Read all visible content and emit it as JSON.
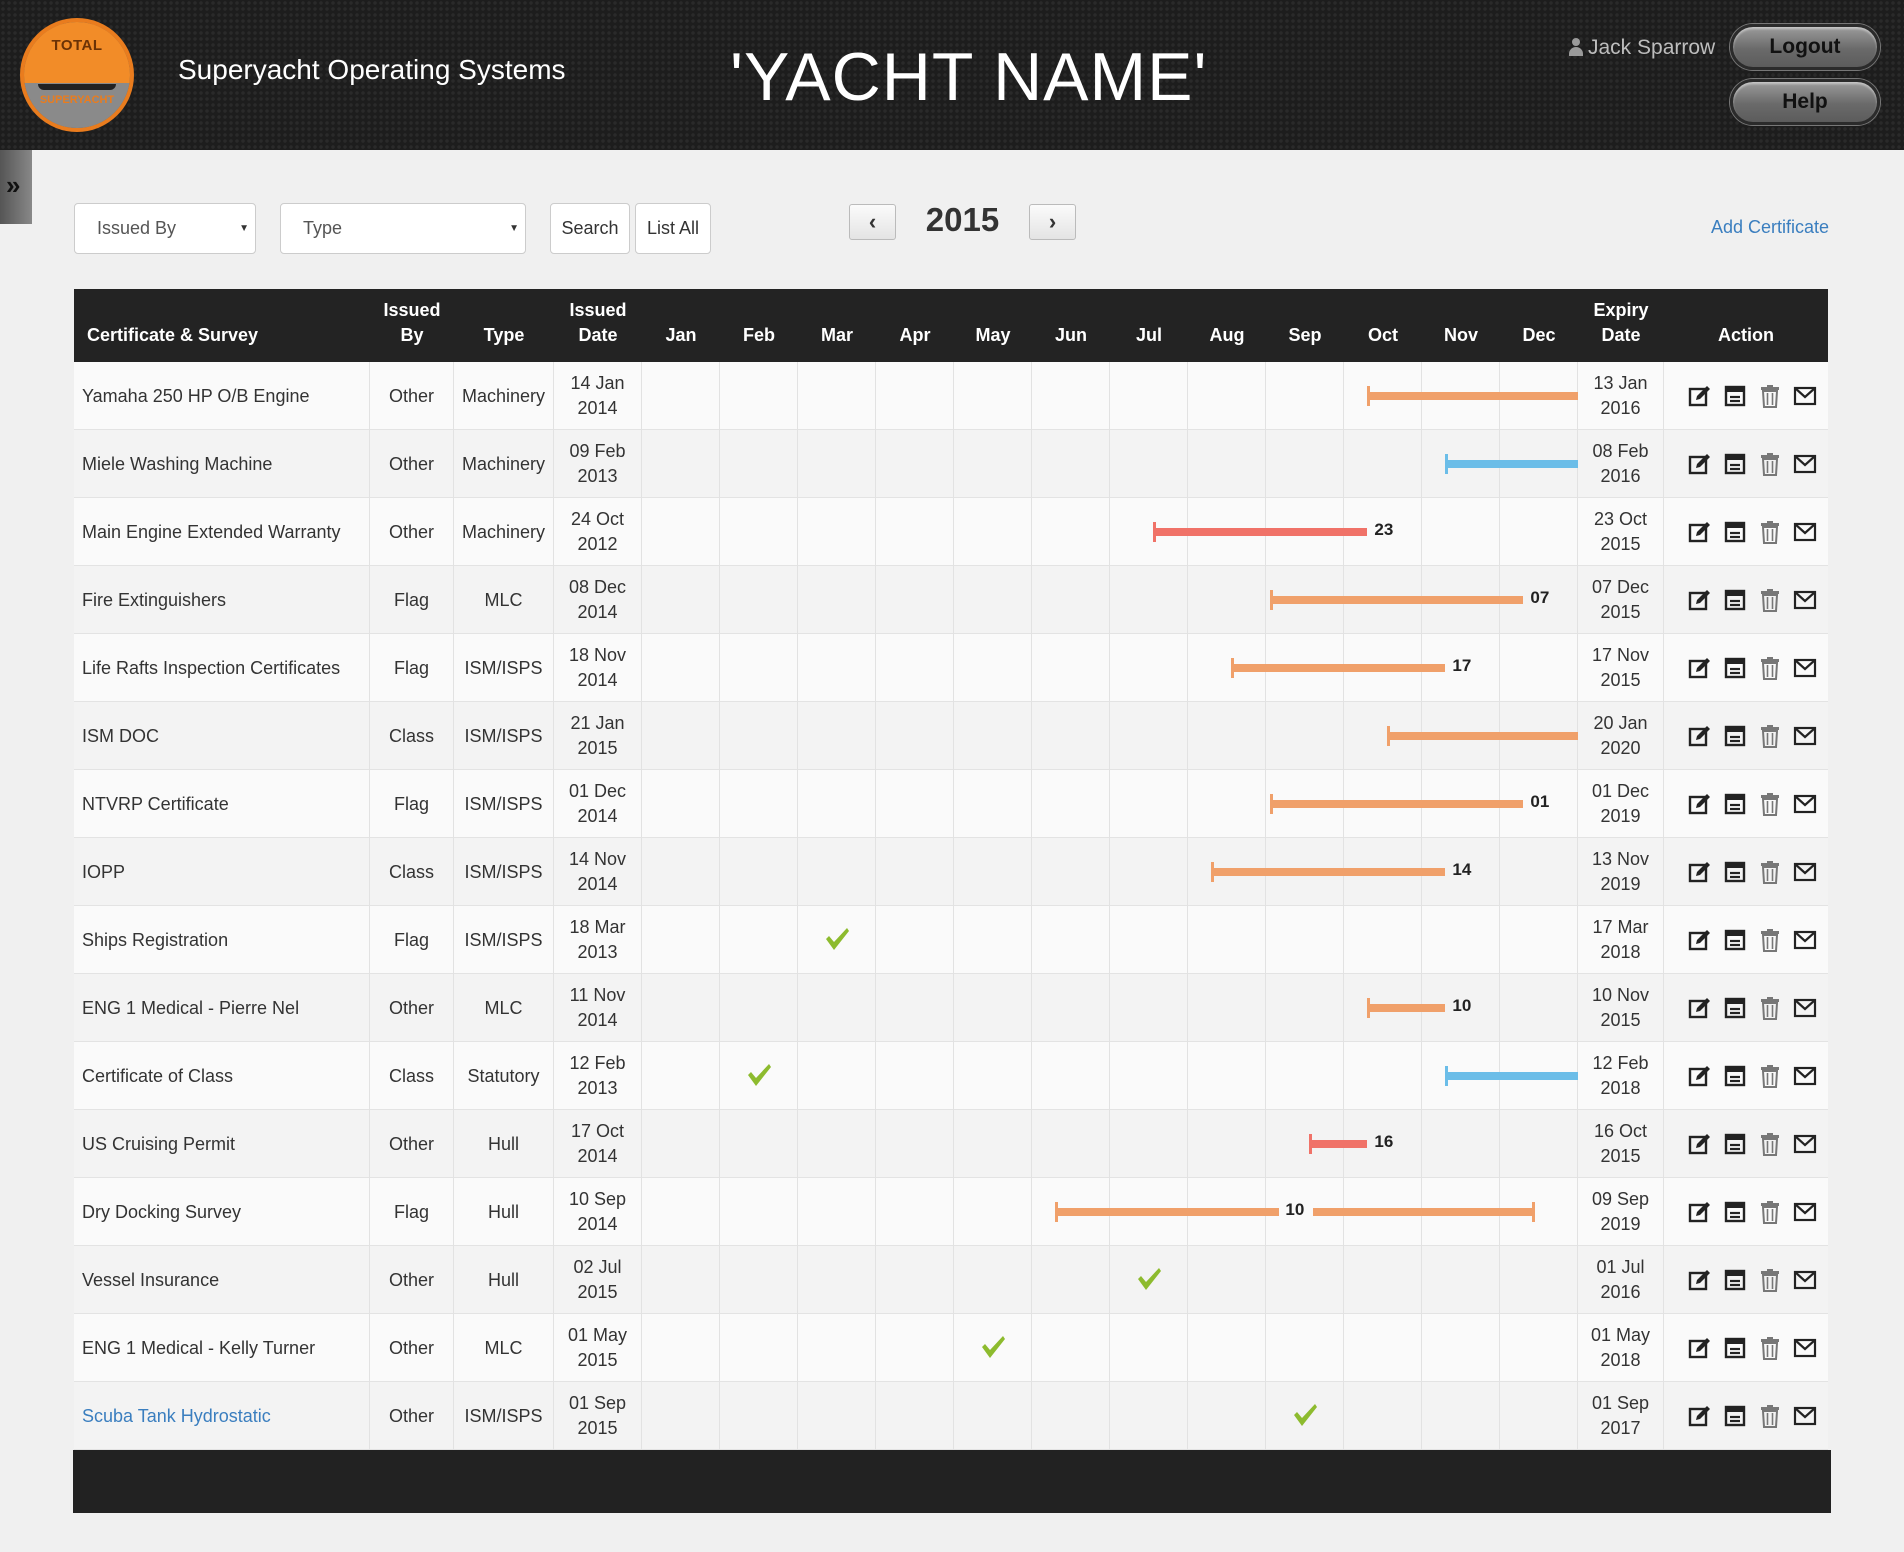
{
  "header": {
    "logo_top_text": "TOTAL",
    "logo_bottom_text": "SUPERYACHT",
    "app_title": "Superyacht Operating Systems",
    "yacht_name": "'YACHT NAME'",
    "user_name": "Jack Sparrow",
    "logout_label": "Logout",
    "help_label": "Help"
  },
  "sidebar": {
    "toggle_glyph": "»"
  },
  "toolbar": {
    "issued_by_placeholder": "Issued By",
    "type_placeholder": "Type",
    "search_label": "Search",
    "list_all_label": "List All",
    "prev_glyph": "‹",
    "next_glyph": "›",
    "year": "2015",
    "add_certificate_label": "Add Certificate"
  },
  "table": {
    "headers": {
      "name": "Certificate & Survey",
      "issued_by": "Issued\nBy",
      "type": "Type",
      "issued_date": "Issued\nDate",
      "expiry_date": "Expiry\nDate",
      "action": "Action"
    },
    "months": [
      "Jan",
      "Feb",
      "Mar",
      "Apr",
      "May",
      "Jun",
      "Jul",
      "Aug",
      "Sep",
      "Oct",
      "Nov",
      "Dec"
    ],
    "colors": {
      "warning": "#f0a06a",
      "ok": "#6bbde8",
      "expired": "#f07268",
      "check": "#8dbb2e"
    },
    "rows": [
      {
        "name": "Yamaha 250 HP O/B Engine",
        "issued_by": "Other",
        "type": "Machinery",
        "issued": "14 Jan\n2014",
        "expiry": "13 Jan\n2016",
        "bar": {
          "color": "warning",
          "start": 9.3,
          "end": 12,
          "label": "",
          "caps": "left"
        }
      },
      {
        "name": "Miele Washing Machine",
        "issued_by": "Other",
        "type": "Machinery",
        "issued": "09 Feb\n2013",
        "expiry": "08 Feb\n2016",
        "bar": {
          "color": "ok",
          "start": 10.3,
          "end": 12,
          "label": "",
          "caps": "left"
        }
      },
      {
        "name": "Main Engine Extended Warranty",
        "issued_by": "Other",
        "type": "Machinery",
        "issued": "24 Oct\n2012",
        "expiry": "23 Oct\n2015",
        "bar": {
          "color": "expired",
          "start": 6.55,
          "end": 9.3,
          "label": "23",
          "caps": "left"
        }
      },
      {
        "name": "Fire Extinguishers",
        "issued_by": "Flag",
        "type": "MLC",
        "issued": "08 Dec\n2014",
        "expiry": "07 Dec\n2015",
        "bar": {
          "color": "warning",
          "start": 8.05,
          "end": 11.3,
          "label": "07",
          "caps": "left"
        }
      },
      {
        "name": "Life Rafts Inspection Certificates",
        "issued_by": "Flag",
        "type": "ISM/ISPS",
        "issued": "18 Nov\n2014",
        "expiry": "17 Nov\n2015",
        "bar": {
          "color": "warning",
          "start": 7.55,
          "end": 10.3,
          "label": "17",
          "caps": "left"
        }
      },
      {
        "name": "ISM DOC",
        "issued_by": "Class",
        "type": "ISM/ISPS",
        "issued": "21 Jan\n2015",
        "expiry": "20 Jan\n2020",
        "bar": {
          "color": "warning",
          "start": 9.55,
          "end": 12,
          "label": "",
          "caps": "left"
        }
      },
      {
        "name": "NTVRP Certificate",
        "issued_by": "Flag",
        "type": "ISM/ISPS",
        "issued": "01 Dec\n2014",
        "expiry": "01 Dec\n2019",
        "bar": {
          "color": "warning",
          "start": 8.05,
          "end": 11.3,
          "label": "01",
          "caps": "left"
        }
      },
      {
        "name": "IOPP",
        "issued_by": "Class",
        "type": "ISM/ISPS",
        "issued": "14 Nov\n2014",
        "expiry": "13 Nov\n2019",
        "bar": {
          "color": "warning",
          "start": 7.3,
          "end": 10.3,
          "label": "14",
          "caps": "left"
        }
      },
      {
        "name": "Ships Registration",
        "issued_by": "Flag",
        "type": "ISM/ISPS",
        "issued": "18 Mar\n2013",
        "expiry": "17 Mar\n2018",
        "check_month": 2.5
      },
      {
        "name": "ENG 1 Medical - Pierre Nel",
        "issued_by": "Other",
        "type": "MLC",
        "issued": "11 Nov\n2014",
        "expiry": "10 Nov\n2015",
        "bar": {
          "color": "warning",
          "start": 9.3,
          "end": 10.3,
          "label": "10",
          "caps": "left"
        }
      },
      {
        "name": "Certificate of Class",
        "issued_by": "Class",
        "type": "Statutory",
        "issued": "12 Feb\n2013",
        "expiry": "12 Feb\n2018",
        "check_month": 1.5,
        "bar": {
          "color": "ok",
          "start": 10.3,
          "end": 12,
          "label": "",
          "caps": "left"
        }
      },
      {
        "name": "US Cruising Permit",
        "issued_by": "Other",
        "type": "Hull",
        "issued": "17 Oct\n2014",
        "expiry": "16 Oct\n2015",
        "bar": {
          "color": "expired",
          "start": 8.55,
          "end": 9.3,
          "label": "16",
          "caps": "left"
        }
      },
      {
        "name": "Dry Docking Survey",
        "issued_by": "Flag",
        "type": "Hull",
        "issued": "10 Sep\n2014",
        "expiry": "09 Sep\n2019",
        "bar": {
          "color": "warning",
          "start": 5.3,
          "end": 11.45,
          "label": "10",
          "caps": "both",
          "label_at": 8.3
        }
      },
      {
        "name": "Vessel Insurance",
        "issued_by": "Other",
        "type": "Hull",
        "issued": "02 Jul\n2015",
        "expiry": "01 Jul\n2016",
        "check_month": 6.5
      },
      {
        "name": "ENG 1 Medical - Kelly Turner",
        "issued_by": "Other",
        "type": "MLC",
        "issued": "01 May\n2015",
        "expiry": "01 May\n2018",
        "check_month": 4.5
      },
      {
        "name": "Scuba Tank Hydrostatic",
        "issued_by": "Other",
        "type": "ISM/ISPS",
        "issued": "01 Sep\n2015",
        "expiry": "01 Sep\n2017",
        "check_month": 8.5,
        "link": true
      }
    ],
    "action_icons": [
      "edit-icon",
      "archive-icon",
      "trash-icon",
      "mail-icon"
    ]
  }
}
